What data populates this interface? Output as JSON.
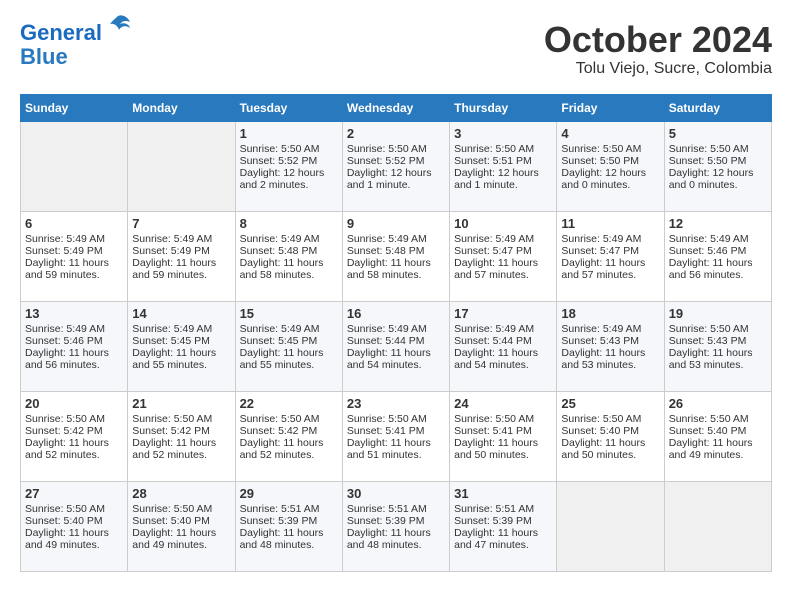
{
  "header": {
    "logo_line1": "General",
    "logo_line2": "Blue",
    "month": "October 2024",
    "location": "Tolu Viejo, Sucre, Colombia"
  },
  "days_of_week": [
    "Sunday",
    "Monday",
    "Tuesday",
    "Wednesday",
    "Thursday",
    "Friday",
    "Saturday"
  ],
  "weeks": [
    [
      {
        "day": "",
        "content": ""
      },
      {
        "day": "",
        "content": ""
      },
      {
        "day": "1",
        "content": "Sunrise: 5:50 AM\nSunset: 5:52 PM\nDaylight: 12 hours\nand 2 minutes."
      },
      {
        "day": "2",
        "content": "Sunrise: 5:50 AM\nSunset: 5:52 PM\nDaylight: 12 hours\nand 1 minute."
      },
      {
        "day": "3",
        "content": "Sunrise: 5:50 AM\nSunset: 5:51 PM\nDaylight: 12 hours\nand 1 minute."
      },
      {
        "day": "4",
        "content": "Sunrise: 5:50 AM\nSunset: 5:50 PM\nDaylight: 12 hours\nand 0 minutes."
      },
      {
        "day": "5",
        "content": "Sunrise: 5:50 AM\nSunset: 5:50 PM\nDaylight: 12 hours\nand 0 minutes."
      }
    ],
    [
      {
        "day": "6",
        "content": "Sunrise: 5:49 AM\nSunset: 5:49 PM\nDaylight: 11 hours\nand 59 minutes."
      },
      {
        "day": "7",
        "content": "Sunrise: 5:49 AM\nSunset: 5:49 PM\nDaylight: 11 hours\nand 59 minutes."
      },
      {
        "day": "8",
        "content": "Sunrise: 5:49 AM\nSunset: 5:48 PM\nDaylight: 11 hours\nand 58 minutes."
      },
      {
        "day": "9",
        "content": "Sunrise: 5:49 AM\nSunset: 5:48 PM\nDaylight: 11 hours\nand 58 minutes."
      },
      {
        "day": "10",
        "content": "Sunrise: 5:49 AM\nSunset: 5:47 PM\nDaylight: 11 hours\nand 57 minutes."
      },
      {
        "day": "11",
        "content": "Sunrise: 5:49 AM\nSunset: 5:47 PM\nDaylight: 11 hours\nand 57 minutes."
      },
      {
        "day": "12",
        "content": "Sunrise: 5:49 AM\nSunset: 5:46 PM\nDaylight: 11 hours\nand 56 minutes."
      }
    ],
    [
      {
        "day": "13",
        "content": "Sunrise: 5:49 AM\nSunset: 5:46 PM\nDaylight: 11 hours\nand 56 minutes."
      },
      {
        "day": "14",
        "content": "Sunrise: 5:49 AM\nSunset: 5:45 PM\nDaylight: 11 hours\nand 55 minutes."
      },
      {
        "day": "15",
        "content": "Sunrise: 5:49 AM\nSunset: 5:45 PM\nDaylight: 11 hours\nand 55 minutes."
      },
      {
        "day": "16",
        "content": "Sunrise: 5:49 AM\nSunset: 5:44 PM\nDaylight: 11 hours\nand 54 minutes."
      },
      {
        "day": "17",
        "content": "Sunrise: 5:49 AM\nSunset: 5:44 PM\nDaylight: 11 hours\nand 54 minutes."
      },
      {
        "day": "18",
        "content": "Sunrise: 5:49 AM\nSunset: 5:43 PM\nDaylight: 11 hours\nand 53 minutes."
      },
      {
        "day": "19",
        "content": "Sunrise: 5:50 AM\nSunset: 5:43 PM\nDaylight: 11 hours\nand 53 minutes."
      }
    ],
    [
      {
        "day": "20",
        "content": "Sunrise: 5:50 AM\nSunset: 5:42 PM\nDaylight: 11 hours\nand 52 minutes."
      },
      {
        "day": "21",
        "content": "Sunrise: 5:50 AM\nSunset: 5:42 PM\nDaylight: 11 hours\nand 52 minutes."
      },
      {
        "day": "22",
        "content": "Sunrise: 5:50 AM\nSunset: 5:42 PM\nDaylight: 11 hours\nand 52 minutes."
      },
      {
        "day": "23",
        "content": "Sunrise: 5:50 AM\nSunset: 5:41 PM\nDaylight: 11 hours\nand 51 minutes."
      },
      {
        "day": "24",
        "content": "Sunrise: 5:50 AM\nSunset: 5:41 PM\nDaylight: 11 hours\nand 50 minutes."
      },
      {
        "day": "25",
        "content": "Sunrise: 5:50 AM\nSunset: 5:40 PM\nDaylight: 11 hours\nand 50 minutes."
      },
      {
        "day": "26",
        "content": "Sunrise: 5:50 AM\nSunset: 5:40 PM\nDaylight: 11 hours\nand 49 minutes."
      }
    ],
    [
      {
        "day": "27",
        "content": "Sunrise: 5:50 AM\nSunset: 5:40 PM\nDaylight: 11 hours\nand 49 minutes."
      },
      {
        "day": "28",
        "content": "Sunrise: 5:50 AM\nSunset: 5:40 PM\nDaylight: 11 hours\nand 49 minutes."
      },
      {
        "day": "29",
        "content": "Sunrise: 5:51 AM\nSunset: 5:39 PM\nDaylight: 11 hours\nand 48 minutes."
      },
      {
        "day": "30",
        "content": "Sunrise: 5:51 AM\nSunset: 5:39 PM\nDaylight: 11 hours\nand 48 minutes."
      },
      {
        "day": "31",
        "content": "Sunrise: 5:51 AM\nSunset: 5:39 PM\nDaylight: 11 hours\nand 47 minutes."
      },
      {
        "day": "",
        "content": ""
      },
      {
        "day": "",
        "content": ""
      }
    ]
  ]
}
